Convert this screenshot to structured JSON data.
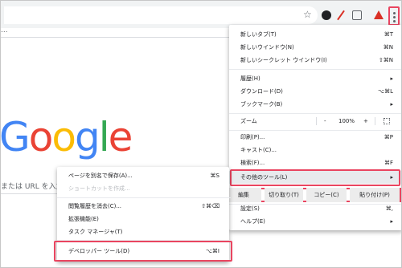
{
  "toolbar": {
    "star_icon": "star-icon",
    "menu_icon": "kebab-menu-icon",
    "bookmarks_overflow": "..."
  },
  "page": {
    "logo": [
      "G",
      "o",
      "o",
      "g",
      "l",
      "e"
    ],
    "logo_colors": [
      "#4285f4",
      "#ea4335",
      "#fbbc05",
      "#4285f4",
      "#34a853",
      "#ea4335"
    ],
    "search_hint": "または URL を入力"
  },
  "menu": {
    "new_tab": "新しいタブ(T)",
    "new_tab_sc": "⌘T",
    "new_window": "新しいウインドウ(N)",
    "new_window_sc": "⌘N",
    "incognito": "新しいシークレット ウインドウ(I)",
    "incognito_sc": "⇧⌘N",
    "history": "履歴(H)",
    "downloads": "ダウンロード(D)",
    "downloads_sc": "⌥⌘L",
    "bookmarks": "ブックマーク(B)",
    "zoom": "ズーム",
    "zoom_minus": "-",
    "zoom_value": "100%",
    "zoom_plus": "+",
    "print": "印刷(P)...",
    "print_sc": "⌘P",
    "cast": "キャスト(C)...",
    "find": "検索(F)...",
    "find_sc": "⌘F",
    "more_tools": "その他のツール(L)",
    "edit": "編集",
    "cut": "切り取り(T)",
    "copy": "コピー(C)",
    "paste": "貼り付け(P)",
    "settings": "設定(S)",
    "settings_sc": "⌘,",
    "help": "ヘルプ(E)",
    "arrow": "▸"
  },
  "submenu": {
    "save_page": "ページを別名で保存(A)...",
    "save_page_sc": "⌘S",
    "create_shortcut": "ショートカットを作成...",
    "clear_data": "閲覧履歴を消去(C)...",
    "clear_data_sc": "⇧⌘⌫",
    "extensions": "拡張機能(E)",
    "task_manager": "タスク マネージャ(T)",
    "devtools": "デベロッパー ツール(D)",
    "devtools_sc": "⌥⌘I"
  },
  "colors": {
    "highlight": "#e94560",
    "hover_bg": "#e8eaed"
  }
}
